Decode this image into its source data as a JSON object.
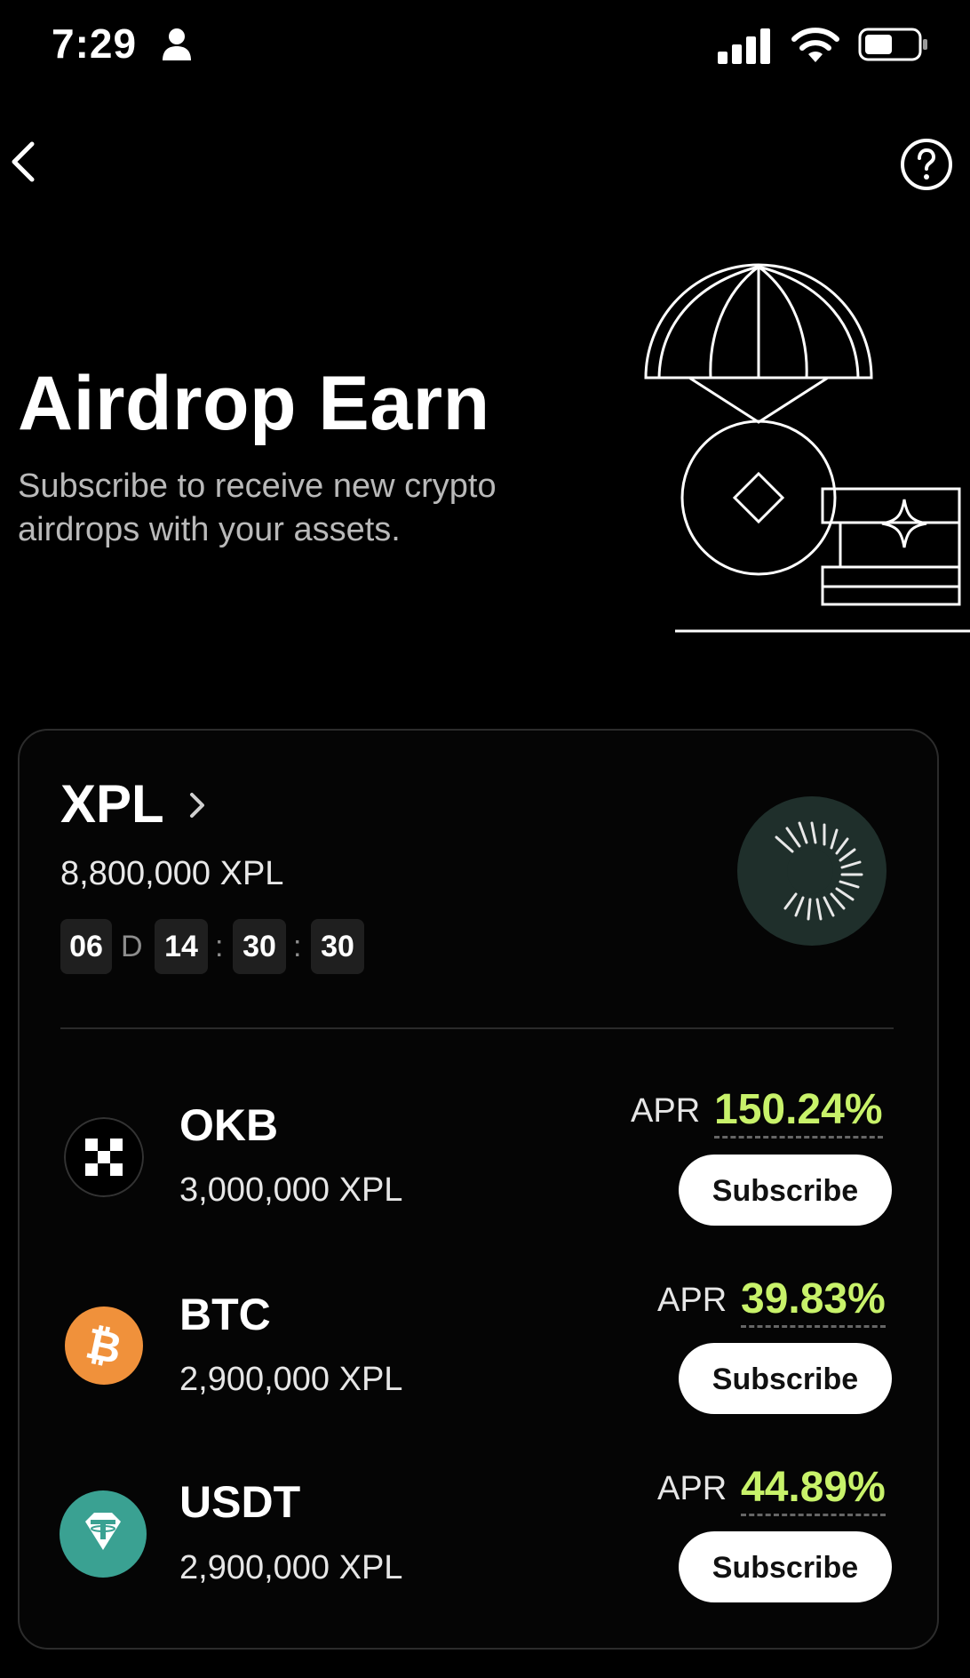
{
  "status_bar": {
    "time": "7:29"
  },
  "hero": {
    "title": "Airdrop Earn",
    "subtitle": "Subscribe to receive new crypto airdrops with your assets."
  },
  "project": {
    "name": "XPL",
    "total_amount": "8,800,000 XPL",
    "countdown": {
      "days": "06",
      "days_unit": "D",
      "hours": "14",
      "minutes": "30",
      "seconds": "30",
      "separator": ":"
    }
  },
  "assets": [
    {
      "name": "OKB",
      "amount": "3,000,000 XPL",
      "apr_label": "APR",
      "apr": "150.24%",
      "button": "Subscribe",
      "icon": "okb-icon",
      "color": "#000000"
    },
    {
      "name": "BTC",
      "amount": "2,900,000 XPL",
      "apr_label": "APR",
      "apr": "39.83%",
      "button": "Subscribe",
      "icon": "btc-icon",
      "color": "#f0913b"
    },
    {
      "name": "USDT",
      "amount": "2,900,000 XPL",
      "apr_label": "APR",
      "apr": "44.89%",
      "button": "Subscribe",
      "icon": "usdt-icon",
      "color": "#3aa192"
    }
  ],
  "colors": {
    "background": "#000000",
    "apr_green": "#c8f26a",
    "card_border": "#2c2c2c"
  }
}
